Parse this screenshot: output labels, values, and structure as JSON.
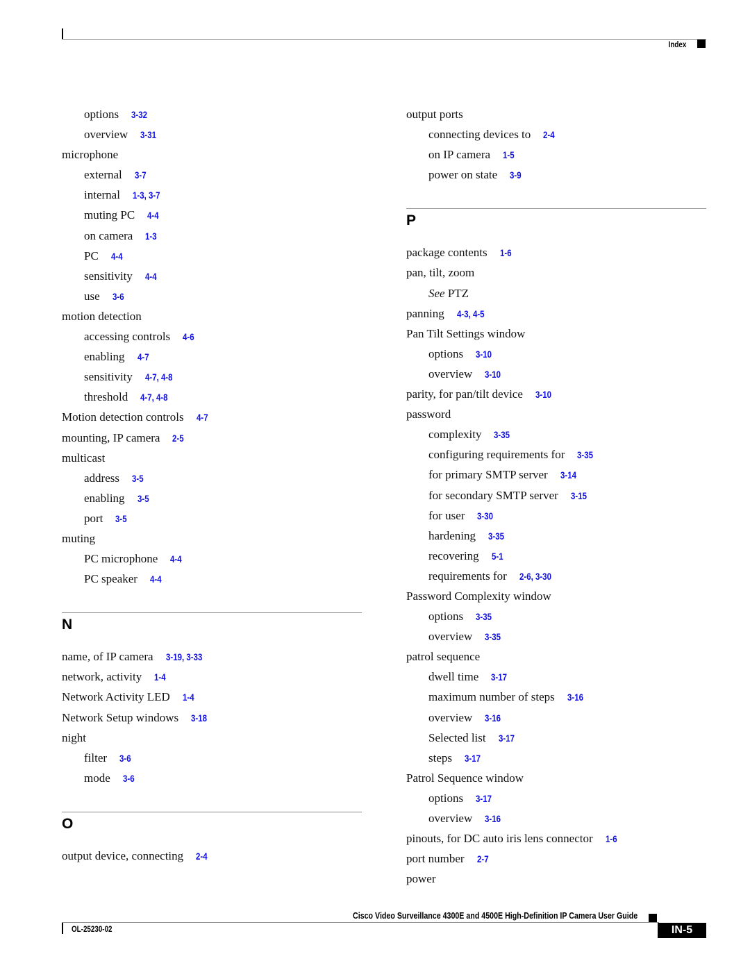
{
  "header": {
    "section_label": "Index"
  },
  "left_column": {
    "block1": [
      {
        "term": "options",
        "pages": "3-32",
        "sub": true
      },
      {
        "term": "overview",
        "pages": "3-31",
        "sub": true
      },
      {
        "term": "microphone",
        "pages": "",
        "sub": false
      },
      {
        "term": "external",
        "pages": "3-7",
        "sub": true
      },
      {
        "term": "internal",
        "pages": "1-3, 3-7",
        "sub": true
      },
      {
        "term": "muting PC",
        "pages": "4-4",
        "sub": true
      },
      {
        "term": "on camera",
        "pages": "1-3",
        "sub": true
      },
      {
        "term": "PC",
        "pages": "4-4",
        "sub": true
      },
      {
        "term": "sensitivity",
        "pages": "4-4",
        "sub": true
      },
      {
        "term": "use",
        "pages": "3-6",
        "sub": true
      },
      {
        "term": "motion detection",
        "pages": "",
        "sub": false
      },
      {
        "term": "accessing controls",
        "pages": "4-6",
        "sub": true
      },
      {
        "term": "enabling",
        "pages": "4-7",
        "sub": true
      },
      {
        "term": "sensitivity",
        "pages": "4-7, 4-8",
        "sub": true
      },
      {
        "term": "threshold",
        "pages": "4-7, 4-8",
        "sub": true
      },
      {
        "term": "Motion detection controls",
        "pages": "4-7",
        "sub": false
      },
      {
        "term": "mounting, IP camera",
        "pages": "2-5",
        "sub": false
      },
      {
        "term": "multicast",
        "pages": "",
        "sub": false
      },
      {
        "term": "address",
        "pages": "3-5",
        "sub": true
      },
      {
        "term": "enabling",
        "pages": "3-5",
        "sub": true
      },
      {
        "term": "port",
        "pages": "3-5",
        "sub": true
      },
      {
        "term": "muting",
        "pages": "",
        "sub": false
      },
      {
        "term": "PC microphone",
        "pages": "4-4",
        "sub": true
      },
      {
        "term": "PC speaker",
        "pages": "4-4",
        "sub": true
      }
    ],
    "section_n": {
      "letter": "N",
      "entries": [
        {
          "term": "name, of IP camera",
          "pages": "3-19, 3-33",
          "sub": false
        },
        {
          "term": "network, activity",
          "pages": "1-4",
          "sub": false
        },
        {
          "term": "Network Activity LED",
          "pages": "1-4",
          "sub": false
        },
        {
          "term": "Network Setup windows",
          "pages": "3-18",
          "sub": false
        },
        {
          "term": "night",
          "pages": "",
          "sub": false
        },
        {
          "term": "filter",
          "pages": "3-6",
          "sub": true
        },
        {
          "term": "mode",
          "pages": "3-6",
          "sub": true
        }
      ]
    },
    "section_o": {
      "letter": "O",
      "entries": [
        {
          "term": "output device, connecting",
          "pages": "2-4",
          "sub": false
        }
      ]
    }
  },
  "right_column": {
    "block1": [
      {
        "term": "output ports",
        "pages": "",
        "sub": false
      },
      {
        "term": "connecting devices to",
        "pages": "2-4",
        "sub": true
      },
      {
        "term": "on IP camera",
        "pages": "1-5",
        "sub": true
      },
      {
        "term": "power on state",
        "pages": "3-9",
        "sub": true
      }
    ],
    "section_p": {
      "letter": "P",
      "see_prefix": "See",
      "entries": [
        {
          "term": "package contents",
          "pages": "1-6",
          "sub": false
        },
        {
          "term": "pan, tilt, zoom",
          "pages": "",
          "sub": false
        },
        {
          "term": "PTZ",
          "pages": "",
          "sub": true,
          "see": true
        },
        {
          "term": "panning",
          "pages": "4-3, 4-5",
          "sub": false
        },
        {
          "term": "Pan Tilt Settings window",
          "pages": "",
          "sub": false
        },
        {
          "term": "options",
          "pages": "3-10",
          "sub": true
        },
        {
          "term": "overview",
          "pages": "3-10",
          "sub": true
        },
        {
          "term": "parity, for pan/tilt device",
          "pages": "3-10",
          "sub": false
        },
        {
          "term": "password",
          "pages": "",
          "sub": false
        },
        {
          "term": "complexity",
          "pages": "3-35",
          "sub": true
        },
        {
          "term": "configuring requirements for",
          "pages": "3-35",
          "sub": true
        },
        {
          "term": "for primary SMTP server",
          "pages": "3-14",
          "sub": true
        },
        {
          "term": "for secondary SMTP server",
          "pages": "3-15",
          "sub": true
        },
        {
          "term": "for user",
          "pages": "3-30",
          "sub": true
        },
        {
          "term": "hardening",
          "pages": "3-35",
          "sub": true
        },
        {
          "term": "recovering",
          "pages": "5-1",
          "sub": true
        },
        {
          "term": "requirements for",
          "pages": "2-6, 3-30",
          "sub": true
        },
        {
          "term": "Password Complexity window",
          "pages": "",
          "sub": false
        },
        {
          "term": "options",
          "pages": "3-35",
          "sub": true
        },
        {
          "term": "overview",
          "pages": "3-35",
          "sub": true
        },
        {
          "term": "patrol sequence",
          "pages": "",
          "sub": false
        },
        {
          "term": "dwell time",
          "pages": "3-17",
          "sub": true
        },
        {
          "term": "maximum number of steps",
          "pages": "3-16",
          "sub": true
        },
        {
          "term": "overview",
          "pages": "3-16",
          "sub": true
        },
        {
          "term": "Selected list",
          "pages": "3-17",
          "sub": true
        },
        {
          "term": "steps",
          "pages": "3-17",
          "sub": true
        },
        {
          "term": "Patrol Sequence window",
          "pages": "",
          "sub": false
        },
        {
          "term": "options",
          "pages": "3-17",
          "sub": true
        },
        {
          "term": "overview",
          "pages": "3-16",
          "sub": true
        },
        {
          "term": "pinouts, for DC auto iris lens connector",
          "pages": "1-6",
          "sub": false
        },
        {
          "term": "port number",
          "pages": "2-7",
          "sub": false
        },
        {
          "term": "power",
          "pages": "",
          "sub": false
        }
      ]
    }
  },
  "footer": {
    "guide_title": "Cisco Video Surveillance 4300E and 4500E High-Definition IP Camera User Guide",
    "doc_number": "OL-25230-02",
    "page_number": "IN-5"
  },
  "colors": {
    "link": "#1010e0",
    "text": "#111111",
    "rule": "#8a8a8a"
  }
}
